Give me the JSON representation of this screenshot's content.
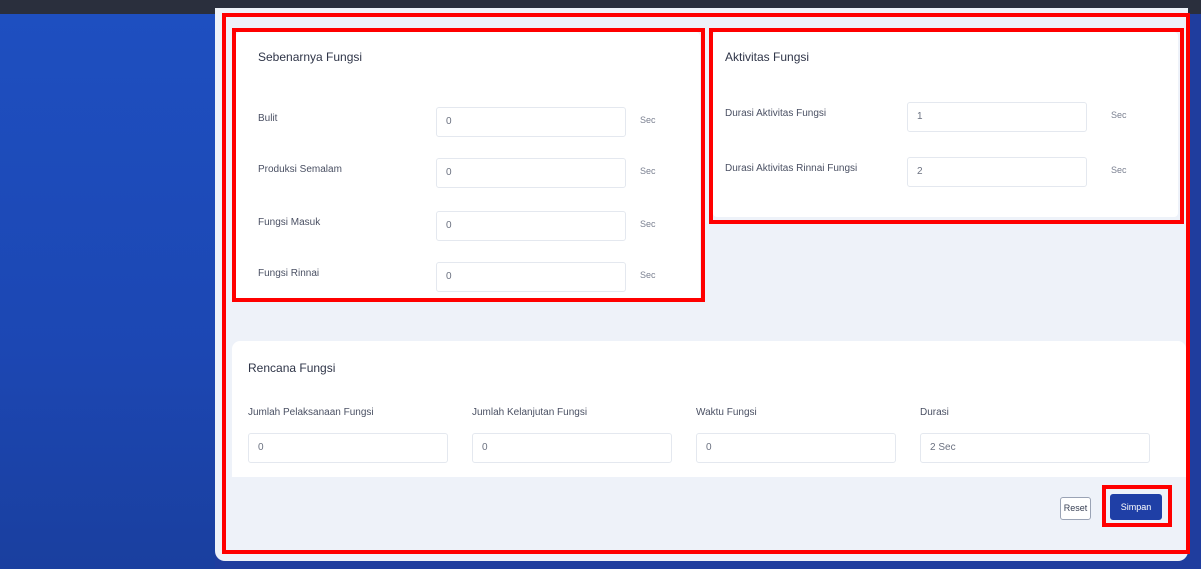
{
  "panels": {
    "left": {
      "title": "Sebenarnya Fungsi",
      "fields": [
        {
          "label": "Bulit",
          "value": "0",
          "unit": "Sec"
        },
        {
          "label": "Produksi Semalam",
          "value": "0",
          "unit": "Sec"
        },
        {
          "label": "Fungsi Masuk",
          "value": "0",
          "unit": "Sec"
        },
        {
          "label": "Fungsi Rinnai",
          "value": "0",
          "unit": "Sec"
        }
      ]
    },
    "right": {
      "title": "Aktivitas Fungsi",
      "fields": [
        {
          "label": "Durasi Aktivitas Fungsi",
          "value": "1",
          "unit": "Sec"
        },
        {
          "label": "Durasi Aktivitas Rinnai Fungsi",
          "value": "2",
          "unit": "Sec"
        }
      ]
    },
    "bottom": {
      "title": "Rencana Fungsi",
      "fields": [
        {
          "label": "Jumlah Pelaksanaan Fungsi",
          "value": "0"
        },
        {
          "label": "Jumlah Kelanjutan Fungsi",
          "value": "0"
        },
        {
          "label": "Waktu Fungsi",
          "value": "0"
        },
        {
          "label": "Durasi",
          "value": "2 Sec"
        }
      ]
    }
  },
  "actions": {
    "reset_label": "Reset",
    "submit_label": "Simpan"
  },
  "colors": {
    "sidebar": "#1e4fc0",
    "highlight": "#ff0000",
    "primary_button": "#1f3fa6"
  }
}
